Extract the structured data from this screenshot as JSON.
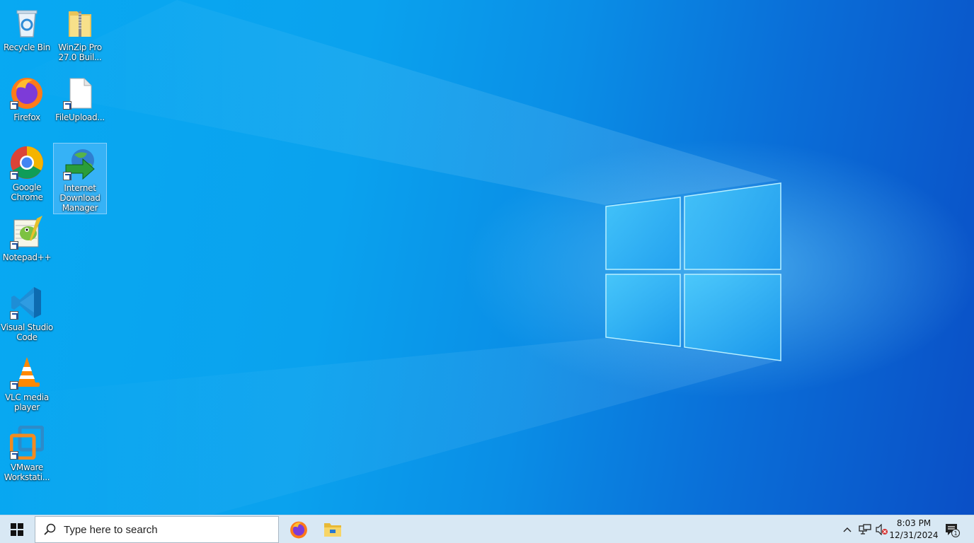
{
  "desktop": {
    "icons": [
      {
        "label": "Recycle Bin",
        "icon": "recycle-bin-icon"
      },
      {
        "label": "WinZip Pro 27.0 Buil...",
        "icon": "winzip-icon"
      },
      {
        "label": "Firefox",
        "icon": "firefox-icon"
      },
      {
        "label": "FileUpload...",
        "icon": "blank-file-icon"
      },
      {
        "label": "Google Chrome",
        "icon": "chrome-icon"
      },
      {
        "label": "Internet Download Manager",
        "icon": "idm-icon"
      },
      {
        "label": "Notepad++",
        "icon": "notepad-plus-plus-icon"
      },
      {
        "label": "Visual Studio Code",
        "icon": "vscode-icon"
      },
      {
        "label": "VLC media player",
        "icon": "vlc-icon"
      },
      {
        "label": "VMware Workstati...",
        "icon": "vmware-icon"
      }
    ]
  },
  "taskbar": {
    "search_placeholder": "Type here to search",
    "pinned": [
      {
        "name": "Firefox",
        "icon": "firefox-icon"
      },
      {
        "name": "File Explorer",
        "icon": "file-explorer-icon"
      }
    ],
    "clock_time": "8:03 PM",
    "clock_date": "12/31/2024",
    "notification_count": "1"
  },
  "colors": {
    "wallpaper_light": "#08a9f2",
    "wallpaper_dark": "#0a4fc6",
    "taskbar_bg": "#d8e8f4"
  }
}
